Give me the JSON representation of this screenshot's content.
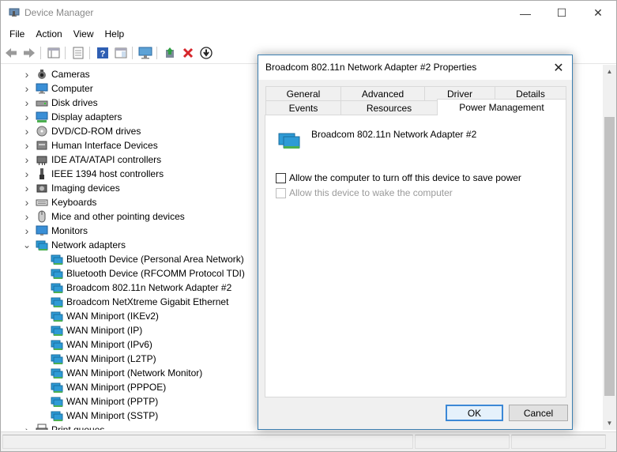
{
  "window": {
    "title": "Device Manager",
    "minimize": "—",
    "maximize": "☐",
    "close": "✕"
  },
  "menu": [
    {
      "label": "File"
    },
    {
      "label": "Action"
    },
    {
      "label": "View"
    },
    {
      "label": "Help"
    }
  ],
  "tree": {
    "categories": [
      {
        "label": "Cameras",
        "icon": "camera-icon",
        "expanded": false
      },
      {
        "label": "Computer",
        "icon": "computer-icon",
        "expanded": false
      },
      {
        "label": "Disk drives",
        "icon": "disk-drive-icon",
        "expanded": false
      },
      {
        "label": "Display adapters",
        "icon": "display-adapter-icon",
        "expanded": false
      },
      {
        "label": "DVD/CD-ROM drives",
        "icon": "dvd-drive-icon",
        "expanded": false
      },
      {
        "label": "Human Interface Devices",
        "icon": "hid-icon",
        "expanded": false
      },
      {
        "label": "IDE ATA/ATAPI controllers",
        "icon": "ide-controller-icon",
        "expanded": false
      },
      {
        "label": "IEEE 1394 host controllers",
        "icon": "ieee1394-icon",
        "expanded": false
      },
      {
        "label": "Imaging devices",
        "icon": "imaging-device-icon",
        "expanded": false
      },
      {
        "label": "Keyboards",
        "icon": "keyboard-icon",
        "expanded": false
      },
      {
        "label": "Mice and other pointing devices",
        "icon": "mouse-icon",
        "expanded": false
      },
      {
        "label": "Monitors",
        "icon": "monitor-icon",
        "expanded": false
      },
      {
        "label": "Network adapters",
        "icon": "network-adapter-icon",
        "expanded": true
      }
    ],
    "network_adapters": [
      "Bluetooth Device (Personal Area Network)",
      "Bluetooth Device (RFCOMM Protocol TDI)",
      "Broadcom 802.11n Network Adapter #2",
      "Broadcom NetXtreme Gigabit Ethernet",
      "WAN Miniport (IKEv2)",
      "WAN Miniport (IP)",
      "WAN Miniport (IPv6)",
      "WAN Miniport (L2TP)",
      "WAN Miniport (Network Monitor)",
      "WAN Miniport (PPPOE)",
      "WAN Miniport (PPTP)",
      "WAN Miniport (SSTP)"
    ],
    "trailing_category": "Print queues"
  },
  "dialog": {
    "title": "Broadcom 802.11n Network Adapter #2 Properties",
    "close": "✕",
    "tabs_back": [
      "General",
      "Advanced",
      "Driver",
      "Details"
    ],
    "tabs_front": [
      "Events",
      "Resources",
      "Power Management"
    ],
    "active_tab": "Power Management",
    "device_name": "Broadcom 802.11n Network Adapter #2",
    "options": [
      {
        "label": "Allow the computer to turn off this device to save power",
        "checked": false,
        "enabled": true
      },
      {
        "label": "Allow this device to wake the computer",
        "checked": false,
        "enabled": false
      }
    ],
    "ok_label": "OK",
    "cancel_label": "Cancel"
  },
  "colors": {
    "accent": "#3c88d6",
    "dialog_border": "#3c7fb1",
    "network_icon": "#2e9bd6",
    "delete_red": "#d6262b"
  }
}
